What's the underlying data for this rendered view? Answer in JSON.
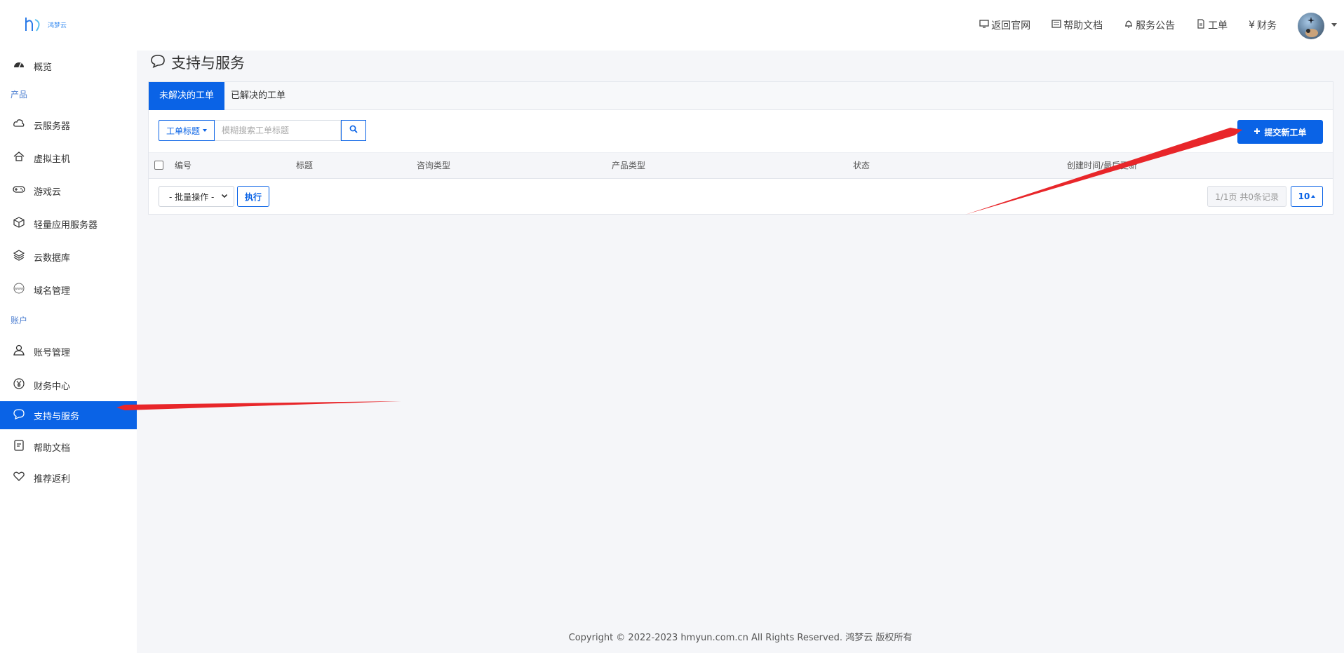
{
  "header": {
    "logo_text": "鸿梦云",
    "nav": [
      {
        "label": "返回官网",
        "icon": "monitor-icon"
      },
      {
        "label": "帮助文档",
        "icon": "book-icon"
      },
      {
        "label": "服务公告",
        "icon": "bell-icon"
      },
      {
        "label": "工单",
        "icon": "file-icon"
      },
      {
        "label": "财务",
        "icon": "yen-icon"
      }
    ],
    "yen_symbol": "¥"
  },
  "sidebar": {
    "overview": "概览",
    "group_products": "产品",
    "items": [
      {
        "label": "云服务器",
        "icon": "cloud-server-icon"
      },
      {
        "label": "虚拟主机",
        "icon": "virtual-host-icon"
      },
      {
        "label": "游戏云",
        "icon": "gamepad-icon"
      },
      {
        "label": "轻量应用服务器",
        "icon": "cube-icon"
      },
      {
        "label": "云数据库",
        "icon": "layers-icon"
      },
      {
        "label": "域名管理",
        "icon": "www-icon"
      }
    ],
    "group_account": "账户",
    "account_items": [
      {
        "label": "账号管理",
        "icon": "user-icon"
      },
      {
        "label": "财务中心",
        "icon": "yen-circle-icon"
      },
      {
        "label": "支持与服务",
        "icon": "chat-icon",
        "active": true
      },
      {
        "label": "帮助文档",
        "icon": "document-icon"
      },
      {
        "label": "推荐返利",
        "icon": "heart-icon"
      }
    ]
  },
  "page": {
    "title": "支持与服务",
    "tabs": [
      "未解决的工单",
      "已解决的工单"
    ],
    "filter": {
      "selected_field": "工单标题",
      "placeholder": "模糊搜索工单标题"
    },
    "submit_label": "提交新工单",
    "columns": [
      "编号",
      "标题",
      "咨询类型",
      "产品类型",
      "状态",
      "创建时间/最后更新"
    ],
    "bulk_action": "- 批量操作 -",
    "exec_label": "执行",
    "page_info": "1/1页 共0条记录",
    "page_size": "10"
  },
  "footer": {
    "copyright": "Copyright © 2022-2023 hmyun.com.cn All Rights Reserved. 鸿梦云 版权所有"
  },
  "annotation_color": "#e8262a",
  "accent_color": "#0a63e6"
}
